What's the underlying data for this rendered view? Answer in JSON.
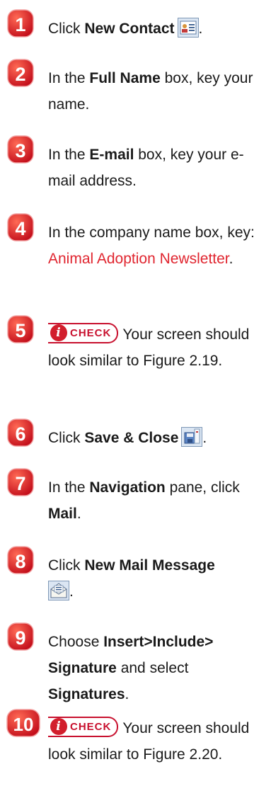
{
  "steps": [
    {
      "number": "1",
      "parts": [
        "Click ",
        "New Contact",
        "."
      ],
      "icon": "new-contact-icon"
    },
    {
      "number": "2",
      "parts": [
        "In the ",
        "Full Name",
        " box, key your name."
      ]
    },
    {
      "number": "3",
      "parts": [
        "In the ",
        "E-mail",
        " box, key your e-mail address."
      ]
    },
    {
      "number": "4",
      "parts": [
        "In the company name box, key: ",
        "Animal Adoption Newsletter",
        "."
      ]
    },
    {
      "number": "5",
      "badge": "CHECK",
      "text": "Your screen should look similar to Figure 2.19."
    },
    {
      "number": "6",
      "parts": [
        "Click ",
        "Save & Close",
        "."
      ],
      "icon": "save-close-icon"
    },
    {
      "number": "7",
      "parts": [
        "In the ",
        "Navigation",
        " pane, click ",
        "Mail",
        "."
      ]
    },
    {
      "number": "8",
      "parts": [
        "Click ",
        "New Mail Message",
        "."
      ],
      "icon": "new-mail-message-icon"
    },
    {
      "number": "9",
      "parts": [
        "Choose ",
        "Insert>Include> Signature",
        " and select ",
        "Signatures",
        "."
      ]
    },
    {
      "number": "10",
      "badge": "CHECK",
      "text": "Your screen should look similar to Figure 2.20."
    }
  ],
  "colors": {
    "step_badge": "#e0252f",
    "link_red": "#e0252f",
    "check_red": "#c8102e"
  }
}
